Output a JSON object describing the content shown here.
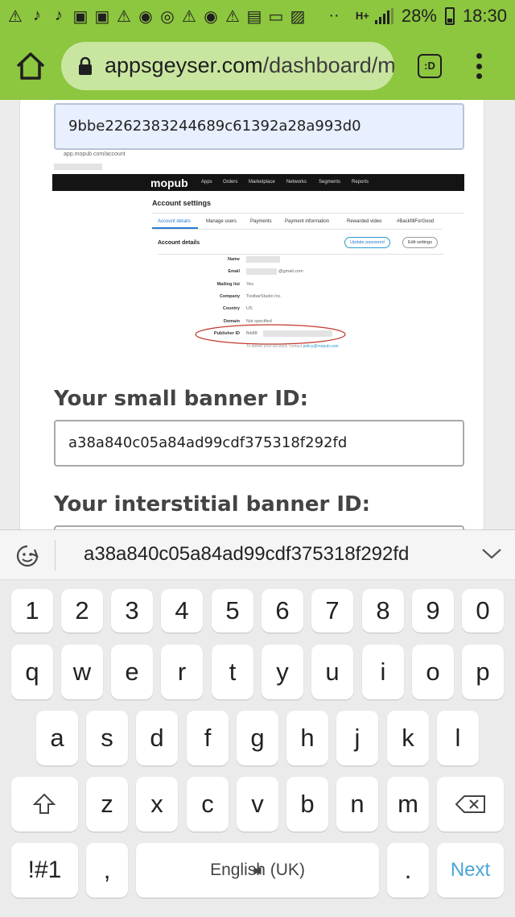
{
  "status_bar": {
    "network": "H+",
    "battery": "28%",
    "time": "18:30",
    "notification_icons": [
      "warning-icon",
      "tiktok-icon",
      "tiktok-icon",
      "bag-icon",
      "bag-icon",
      "warning-icon",
      "messenger-icon",
      "camera-icon",
      "warning-icon",
      "messenger-icon",
      "warning-icon",
      "clipboard-icon",
      "folder-icon",
      "image-icon"
    ]
  },
  "browser": {
    "url_domain": "appsgeyser.com",
    "url_path": "/dashboard/m",
    "ext_label": ":D"
  },
  "form": {
    "publisher_id_value": "9bbe2262383244689c61392a28a993d0",
    "small_banner_label": "Your small banner ID:",
    "small_banner_value": "a38a840c05a84ad99cdf375318f292fd",
    "interstitial_label": "Your interstitial banner ID:"
  },
  "mopub_screenshot": {
    "url": "app.mopub.com/account",
    "logo": "mopub",
    "nav": [
      "Apps",
      "Orders",
      "Marketplace",
      "Networks",
      "Segments",
      "Reports"
    ],
    "title": "Account settings",
    "tabs": [
      "Account details",
      "Manage users",
      "Payments",
      "Payment information",
      "Rewarded video",
      "#BackfillForGood"
    ],
    "section": "Account details",
    "update_password": "Update password",
    "edit_settings": "Edit settings",
    "rows": [
      {
        "label": "Name",
        "value": ""
      },
      {
        "label": "Email",
        "value": "@gmail.com"
      },
      {
        "label": "Mailing list",
        "value": "Yes"
      },
      {
        "label": "Company",
        "value": "ToolbarStudio Inc."
      },
      {
        "label": "Country",
        "value": "US"
      },
      {
        "label": "Domain",
        "value": "Not specified"
      },
      {
        "label": "Publisher ID",
        "value": "fbb88"
      }
    ],
    "footer_text": "To delete your account, contact",
    "footer_link": "policy@mopub.com"
  },
  "keyboard": {
    "suggestion": "a38a840c05a84ad99cdf375318f292fd",
    "number_row": [
      "1",
      "2",
      "3",
      "4",
      "5",
      "6",
      "7",
      "8",
      "9",
      "0"
    ],
    "row1": [
      "q",
      "w",
      "e",
      "r",
      "t",
      "y",
      "u",
      "i",
      "o",
      "p"
    ],
    "row2": [
      "a",
      "s",
      "d",
      "f",
      "g",
      "h",
      "j",
      "k",
      "l"
    ],
    "row3": [
      "z",
      "x",
      "c",
      "v",
      "b",
      "n",
      "m"
    ],
    "symbols_key": "!#1",
    "comma_key": ",",
    "space_label": "English (UK)",
    "period_key": ".",
    "next_key": "Next"
  },
  "colors": {
    "chrome_green": "#8dc63f",
    "urlbar": "#c9e6a0",
    "field_focus": "#e8efff",
    "next_blue": "#4aa5d8"
  }
}
